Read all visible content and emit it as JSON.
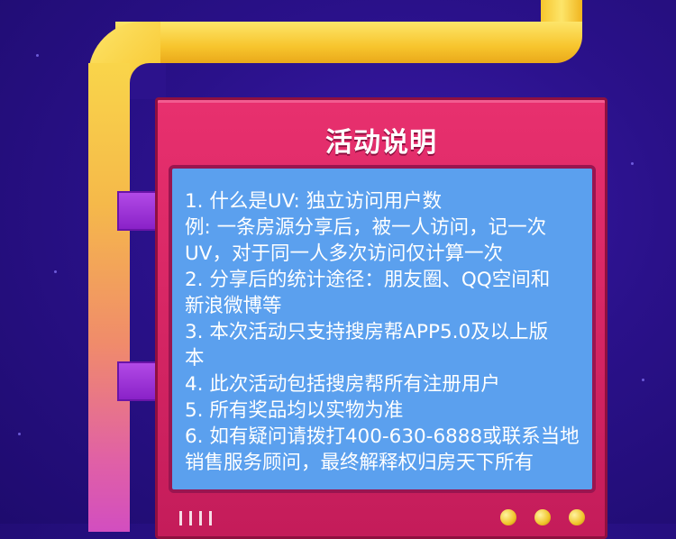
{
  "panel": {
    "title": "活动说明",
    "lines": [
      "1. 什么是UV: 独立访问用户数",
      "例: 一条房源分享后，被一人访问，记一次",
      "UV，对于同一人多次访问仅计算一次",
      "2. 分享后的统计途径：朋友圈、QQ空间和",
      "新浪微博等",
      "3. 本次活动只支持搜房帮APP5.0及以上版",
      "本",
      "4. 此次活动包括搜房帮所有注册用户",
      "5. 所有奖品均以实物为准",
      "6. 如有疑问请拨打400-630-6888或联系当地",
      "销售服务顾问，最终解释权归房天下所有"
    ]
  },
  "colors": {
    "background": "#2a118a",
    "frame": "#e8306e",
    "screen": "#5ba0ee",
    "pipe": "#f7c52d",
    "connector": "#9a30d6"
  }
}
